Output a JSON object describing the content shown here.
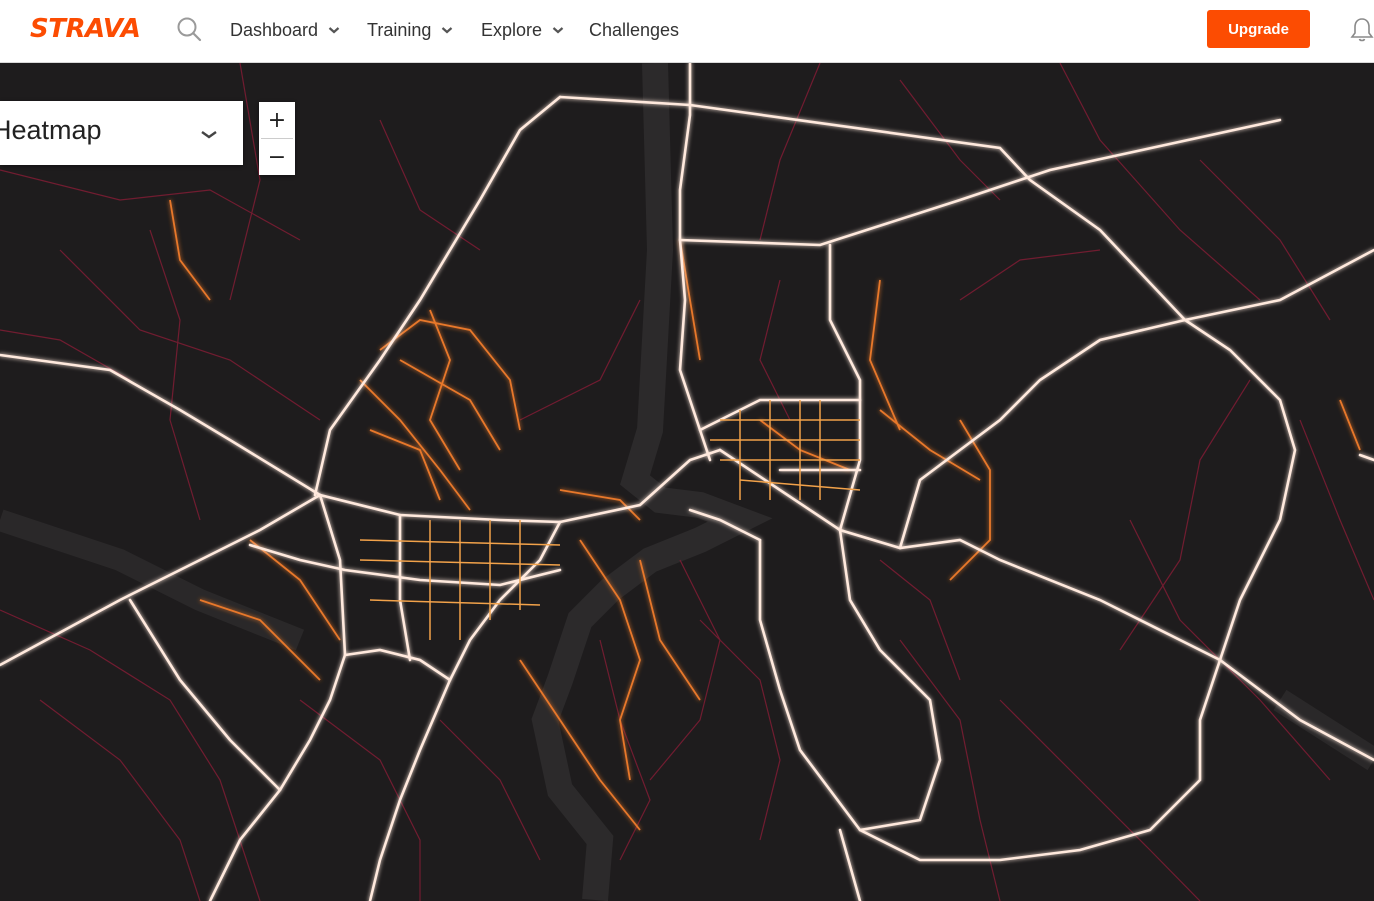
{
  "brand": {
    "logo": "STRAVA",
    "accent": "#fc4c02"
  },
  "nav": {
    "dashboard": "Dashboard",
    "training": "Training",
    "explore": "Explore",
    "challenges": "Challenges"
  },
  "header": {
    "upgrade_label": "Upgrade"
  },
  "icons": {
    "search": "search-icon",
    "bell": "bell-icon",
    "chevron": "chevron-down-icon"
  },
  "map": {
    "layer_label": "Heatmap",
    "zoom_in": "+",
    "zoom_out": "−"
  },
  "colors": {
    "heat_low": "#7a1c33",
    "heat_mid": "#e8782a",
    "heat_high": "#ffe9dd",
    "background": "#1e1c1d"
  }
}
